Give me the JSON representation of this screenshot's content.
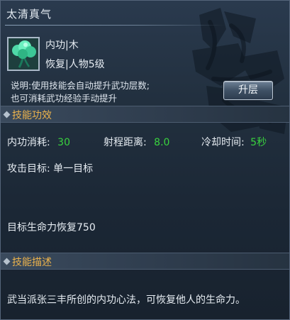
{
  "window": {
    "title": "太清真气"
  },
  "skill": {
    "icon": "jade-cloud-skill-icon",
    "type_line": "内功|木",
    "effect_line": "恢复|人物5级",
    "description_line1": "说明:使用技能会自动提升武功层数;",
    "description_line2": "也可消耗武功经验手动提升",
    "upgrade_label": "升层"
  },
  "effects_section": {
    "header": "技能功效",
    "cost_label": "内功消耗:",
    "cost_value": "30",
    "range_label": "射程距离:",
    "range_value": "8.0",
    "cooldown_label": "冷却时间:",
    "cooldown_value": "5秒",
    "target_text": "攻击目标:  单一目标",
    "heal_text": "目标生命力恢复750"
  },
  "description_section": {
    "header": "技能描述",
    "text": "武当派张三丰所创的内功心法，可恢复他人的生命力。"
  },
  "colors": {
    "accent_gold": "#ebb24c",
    "value_green": "#39d23e",
    "panel_bg": "#22303f"
  }
}
